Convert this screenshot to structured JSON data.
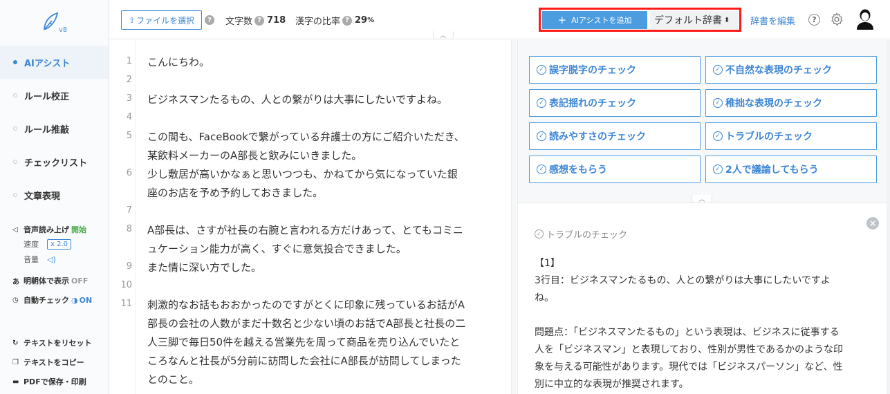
{
  "app": {
    "version": "v8",
    "colors": {
      "accent": "#3d86d4",
      "button": "#4c9ce0",
      "highlight": "#ff1a1a",
      "on_green": "#4caf50"
    }
  },
  "sidebar": {
    "items": [
      {
        "label": "AIアシスト",
        "active": true
      },
      {
        "label": "ルール校正",
        "active": false
      },
      {
        "label": "ルール推敲",
        "active": false
      },
      {
        "label": "チェックリスト",
        "active": false
      },
      {
        "label": "文章表現",
        "active": false
      }
    ],
    "speech": {
      "label": "音声読み上げ",
      "state": "開始",
      "speed_label": "速度",
      "speed_value": "x 2.0",
      "volume_label": "音量"
    },
    "mincho": {
      "label": "明朝体で表示",
      "state": "OFF"
    },
    "autocheck": {
      "label": "自動チェック",
      "state": "ON"
    },
    "reset_label": "テキストをリセット",
    "copy_label": "テキストをコピー",
    "pdf_label": "PDFで保存・印刷"
  },
  "topbar": {
    "file_button": "ファイルを選択",
    "char_count_label": "文字数",
    "char_count": "718",
    "kanji_ratio_label": "漢字の比率",
    "kanji_ratio": "29",
    "kanji_ratio_unit": "%",
    "ai_add_button": "AIアシストを追加",
    "dictionary": "デフォルト辞書",
    "edit_dictionary": "辞書を編集"
  },
  "editor": {
    "line_numbers": [
      "1",
      "2",
      "3",
      "4",
      "5",
      "6",
      "7",
      "8",
      "9",
      "10",
      "11"
    ],
    "lines": [
      "こんにちわ。",
      "",
      "ビジネスマンたるもの、人との繋がりは大事にしたいですよね。",
      "",
      "この間も、FaceBookで繋がっている弁護士の方にご紹介いただき、",
      "某飲料メーカーのA部長と飲みにいきました。",
      "少し敷居が高いかなぁと思いつつも、かねてから気になっていた銀",
      "座のお店を予め予約しておきました。",
      "",
      "A部長は、さすが社長の右腕と言われる方だけあって、とてもコミニ",
      "ュケーション能力が高く、すぐに意気投合できました。",
      "また情に深い方でした。",
      "",
      "刺激的なお話もおおかったのですがとくに印象に残っているお話がA",
      "部長の会社の人数がまだ十数名と少ない頃のお話でA部長と社長の二",
      "人三脚で毎日50件を越える営業先を周って商品を売り込んでいたと",
      "ころなんと社長が5分前に訪問した会社にA部長が訪問してしまった",
      "とのこと。"
    ]
  },
  "checks": [
    "誤字脱字のチェック",
    "不自然な表現のチェック",
    "表記揺れのチェック",
    "稚拙な表現のチェック",
    "読みやすさのチェック",
    "トラブルのチェック",
    "感想をもらう",
    "2人で議論してもらう"
  ],
  "result": {
    "title": "トラブルのチェック",
    "lines": [
      "【1】",
      "3行目：ビジネスマンたるもの、人との繋がりは大事にしたいですよ",
      "ね。",
      "",
      "問題点：「ビジネスマンたるもの」という表現は、ビジネスに従事する",
      "人を「ビジネスマン」と表現しており、性別が男性であるかのような印",
      "象を与える可能性があります。現代では「ビジネスパーソン」など、性",
      "別に中立的な表現が推奨されます。"
    ]
  }
}
